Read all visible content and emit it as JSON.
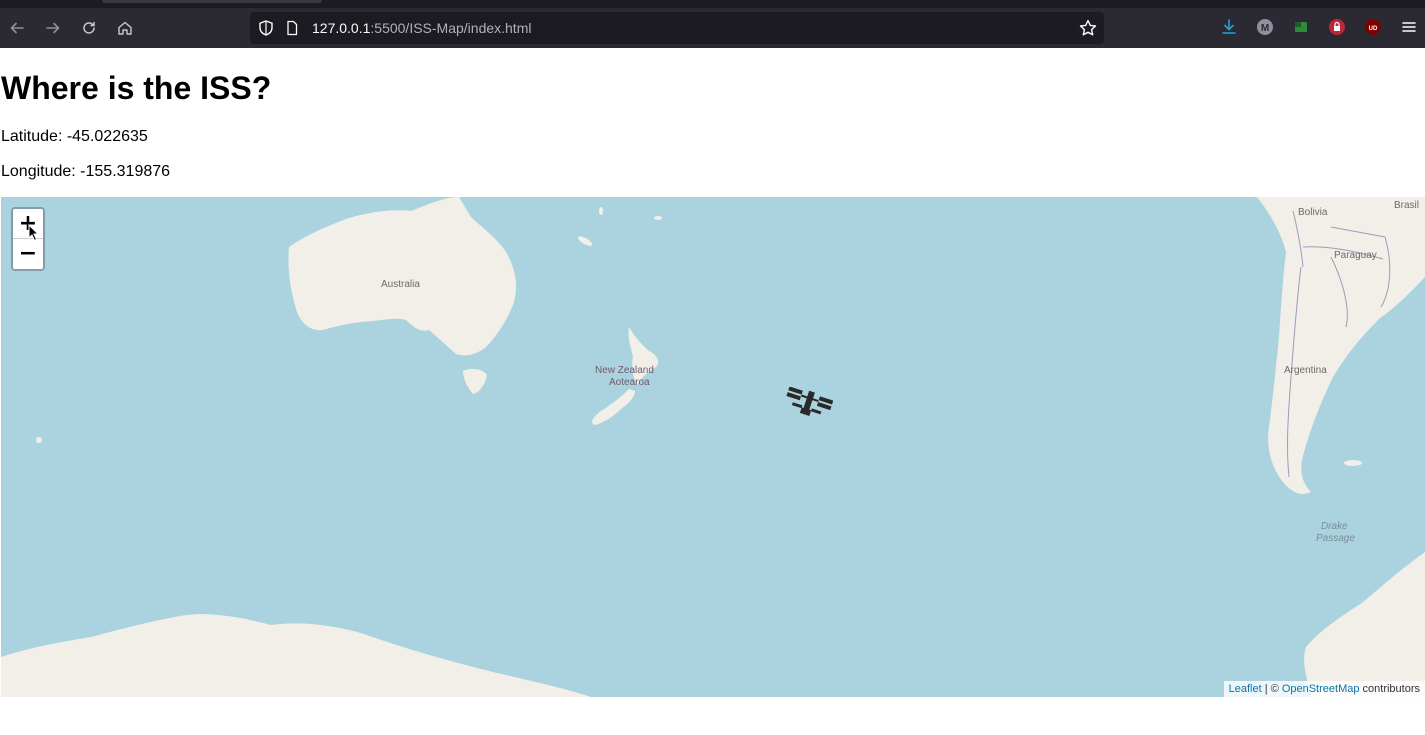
{
  "browser": {
    "url_host": "127.0.0.1",
    "url_rest": ":5500/ISS-Map/index.html",
    "nav_icons": [
      "back-arrow-icon",
      "forward-arrow-icon",
      "reload-icon",
      "home-icon"
    ],
    "extensions": [
      {
        "name": "download-icon",
        "color": "#1fa3d6"
      },
      {
        "name": "m-extension-icon",
        "color": "#8f8f9d",
        "text": "M"
      },
      {
        "name": "green-extension-icon",
        "color": "#2e8b3a"
      },
      {
        "name": "lock-extension-icon",
        "color": "#c0263a"
      },
      {
        "name": "ublock-icon",
        "color": "#800000",
        "text": "UD"
      },
      {
        "name": "menu-icon",
        "color": "#fbfbfe"
      }
    ]
  },
  "page": {
    "title": "Where is the ISS?",
    "latitude_label": "Latitude: -45.022635",
    "longitude_label": "Longitude: -155.319876"
  },
  "map": {
    "zoom_in": "+",
    "zoom_out": "−",
    "labels": {
      "australia": "Australia",
      "new_zealand": "New Zealand",
      "aotearoa": "Aotearoa",
      "bolivia": "Bolivia",
      "paraguay": "Paraguay",
      "argentina": "Argentina",
      "brasil": "Brasil",
      "drake": "Drake",
      "passage": "Passage"
    },
    "attribution": {
      "leaflet": "Leaflet",
      "separator": " | © ",
      "osm": "OpenStreetMap",
      "contributors": " contributors"
    },
    "colors": {
      "water": "#aad3df",
      "land": "#f2efe9",
      "border": "#9e9ab8"
    },
    "marker_icon": "iss-station-icon"
  }
}
